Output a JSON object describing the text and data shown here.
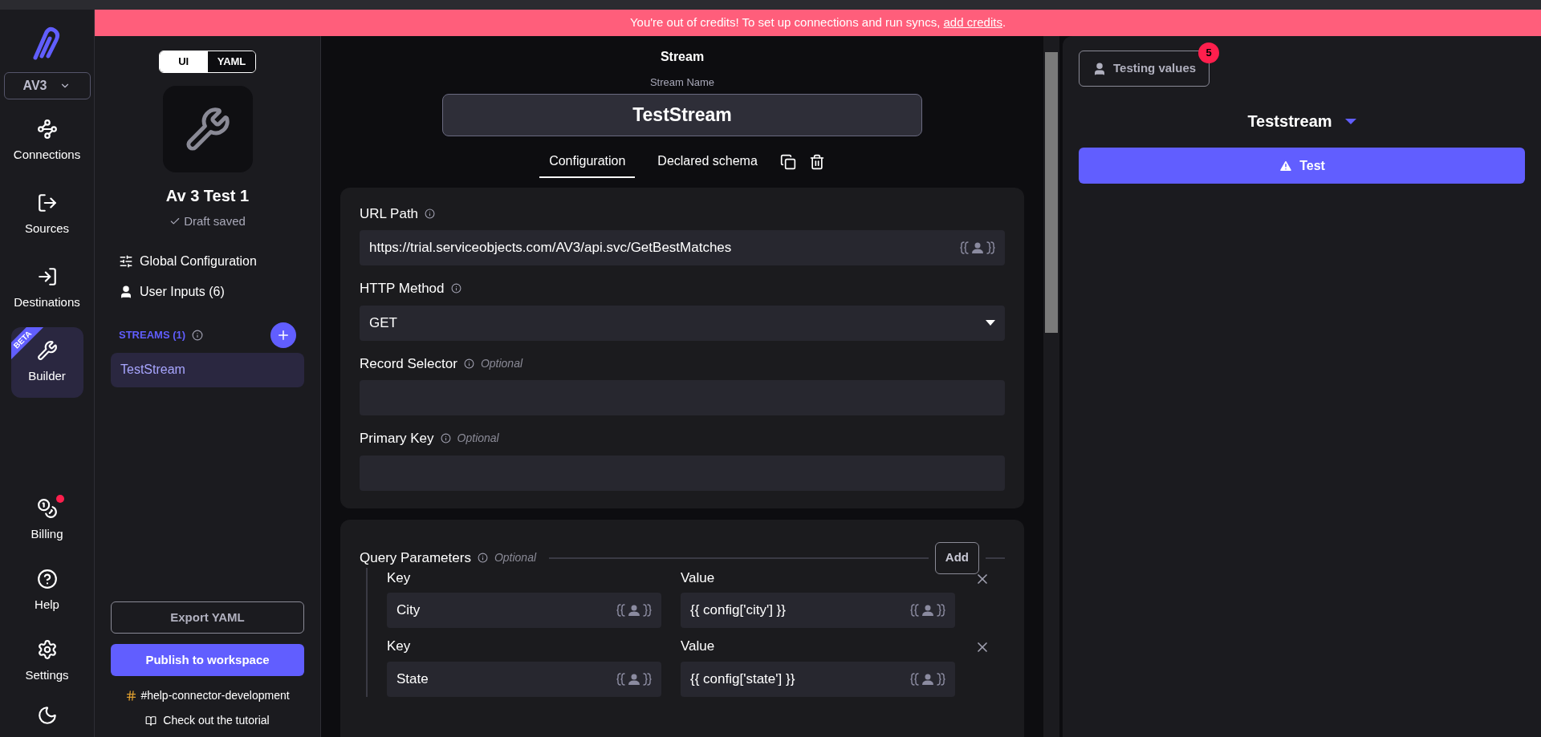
{
  "banner": {
    "text": "You're out of credits! To set up connections and run syncs, ",
    "link": "add credits",
    "trailing": "."
  },
  "nav": {
    "workspace": "AV3",
    "items": [
      {
        "label": "Connections",
        "selected": false,
        "notification": false
      },
      {
        "label": "Sources",
        "selected": false,
        "notification": false
      },
      {
        "label": "Destinations",
        "selected": false,
        "notification": false
      },
      {
        "label": "Builder",
        "selected": true,
        "notification": false,
        "ribbon": "BETA"
      }
    ],
    "bottom_items": [
      {
        "label": "Billing",
        "selected": false,
        "notification": true
      },
      {
        "label": "Help",
        "selected": false,
        "notification": false
      },
      {
        "label": "Settings",
        "selected": false,
        "notification": false
      }
    ]
  },
  "sidebar": {
    "mode_toggle": [
      {
        "label": "UI",
        "selected": true
      },
      {
        "label": "YAML",
        "selected": false
      }
    ],
    "connector_name": "Av 3 Test 1",
    "status": "Draft saved",
    "links": [
      "Global Configuration",
      "User Inputs (6)"
    ],
    "streams_heading": "STREAMS (1)",
    "streams": [
      {
        "name": "TestStream",
        "selected": true
      }
    ],
    "export_button": "Export YAML",
    "publish_button": "Publish to workspace",
    "slack_link": "#help-connector-development",
    "tutorial_link": "Check out the tutorial"
  },
  "main": {
    "heading": "Stream",
    "name_label": "Stream Name",
    "name_value": "TestStream",
    "tabs": [
      {
        "label": "Configuration",
        "selected": true
      },
      {
        "label": "Declared schema",
        "selected": false
      }
    ],
    "fields": [
      {
        "label": "URL Path",
        "kind": "text",
        "value": "https://trial.serviceobjects.com/AV3/api.svc/GetBestMatches"
      },
      {
        "label": "HTTP Method",
        "kind": "select",
        "value": "GET"
      },
      {
        "label": "Record Selector",
        "kind": "text",
        "optional": "Optional"
      },
      {
        "label": "Primary Key",
        "kind": "text",
        "optional": "Optional"
      }
    ],
    "query_parameters": {
      "label": "Query Parameters",
      "optional": "Optional",
      "add_button": "Add",
      "rows": [
        {
          "key_label": "Key",
          "key": "City",
          "value_label": "Value",
          "value": "{{ config['city'] }}"
        },
        {
          "key_label": "Key",
          "key": "State",
          "value_label": "Value",
          "value": "{{ config['state'] }}"
        }
      ]
    }
  },
  "test_panel": {
    "testing_values": "Testing values",
    "badge": "5",
    "stream_select": "Teststream",
    "test_button": "Test"
  }
}
